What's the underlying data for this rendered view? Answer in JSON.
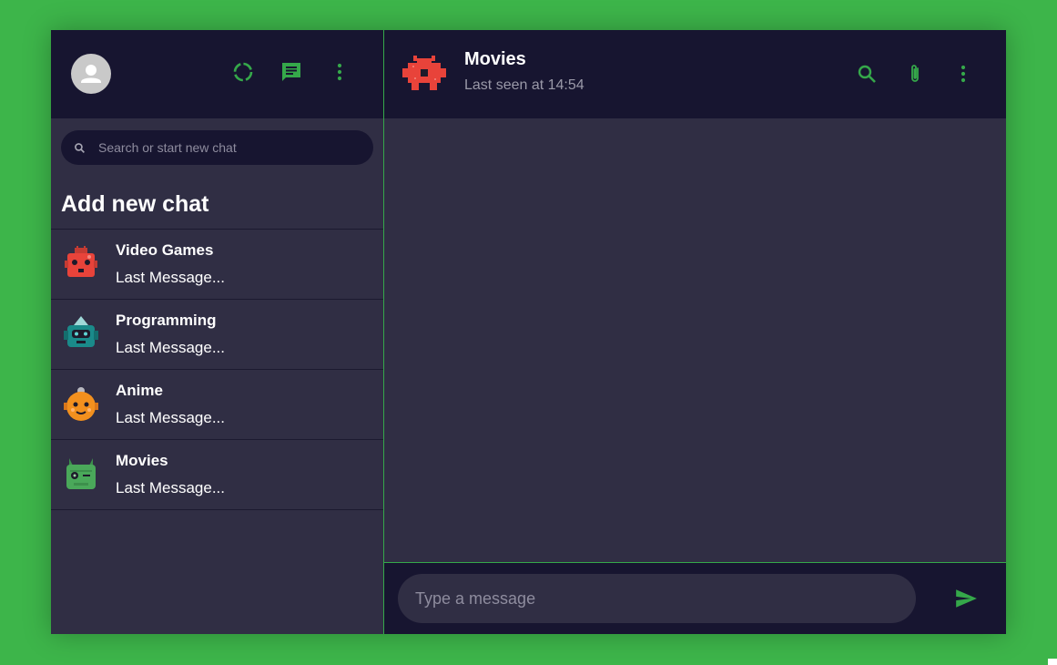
{
  "colors": {
    "background": "#3db54a",
    "accent": "#35a84a",
    "header": "#171530",
    "panel": "#302e44"
  },
  "sidebar": {
    "header_icons": [
      "status-icon",
      "chat-icon",
      "more-vert-icon"
    ],
    "search": {
      "placeholder": "Search or start new chat",
      "value": ""
    },
    "add_new_chat": "Add new chat",
    "chats": [
      {
        "name": "Video Games",
        "last_message": "Last Message...",
        "avatar_color": "#e8433a"
      },
      {
        "name": "Programming",
        "last_message": "Last Message...",
        "avatar_color": "#1a8a8a"
      },
      {
        "name": "Anime",
        "last_message": "Last Message...",
        "avatar_color": "#f2901e"
      },
      {
        "name": "Movies",
        "last_message": "Last Message...",
        "avatar_color": "#4aa85a"
      }
    ]
  },
  "chat": {
    "room_name": "Movies",
    "last_seen": "Last seen at 14:54",
    "header_icons": [
      "search-icon",
      "attach-icon",
      "more-vert-icon"
    ],
    "composer": {
      "placeholder": "Type a message",
      "value": ""
    }
  }
}
